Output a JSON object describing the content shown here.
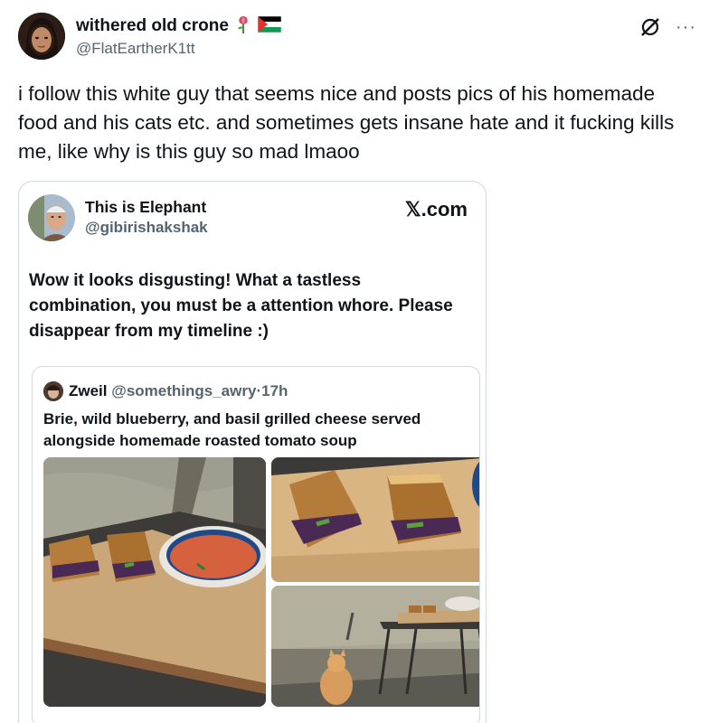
{
  "author": {
    "display_name": "withered old crone",
    "handle": "@FlatEartherK1tt",
    "avatar_icon": "profile-photo",
    "badges": [
      "flower-emoji-icon",
      "palestine-flag-icon"
    ]
  },
  "toolbar": {
    "grok_icon": "grok-icon",
    "more_label": "···"
  },
  "post": {
    "text": "i follow this white guy that seems nice and posts pics of his homemade food and his cats etc. and sometimes gets insane hate and it fucking kills me, like why is this guy so mad lmaoo"
  },
  "card": {
    "display_name": "This is Elephant",
    "handle": "@gibirishakshak",
    "source_label": "𝕏.com",
    "text": "Wow it looks disgusting! What a tastless combination, you must be a attention whore. Please disappear from my timeline :)",
    "quote": {
      "display_name": "Zweil",
      "handle": "@somethings_awry",
      "separator": "·",
      "time": "17h",
      "text": "Brie, wild blueberry, and basil grilled cheese served alongside homemade roasted tomato soup",
      "photos": [
        "grilled-cheese-and-soup-photo",
        "grilled-cheese-closeup-photo",
        "cat-by-table-photo"
      ]
    }
  },
  "colors": {
    "text_primary": "#0f1419",
    "text_secondary": "#536471",
    "border": "#cfd9de",
    "background": "#ffffff"
  }
}
